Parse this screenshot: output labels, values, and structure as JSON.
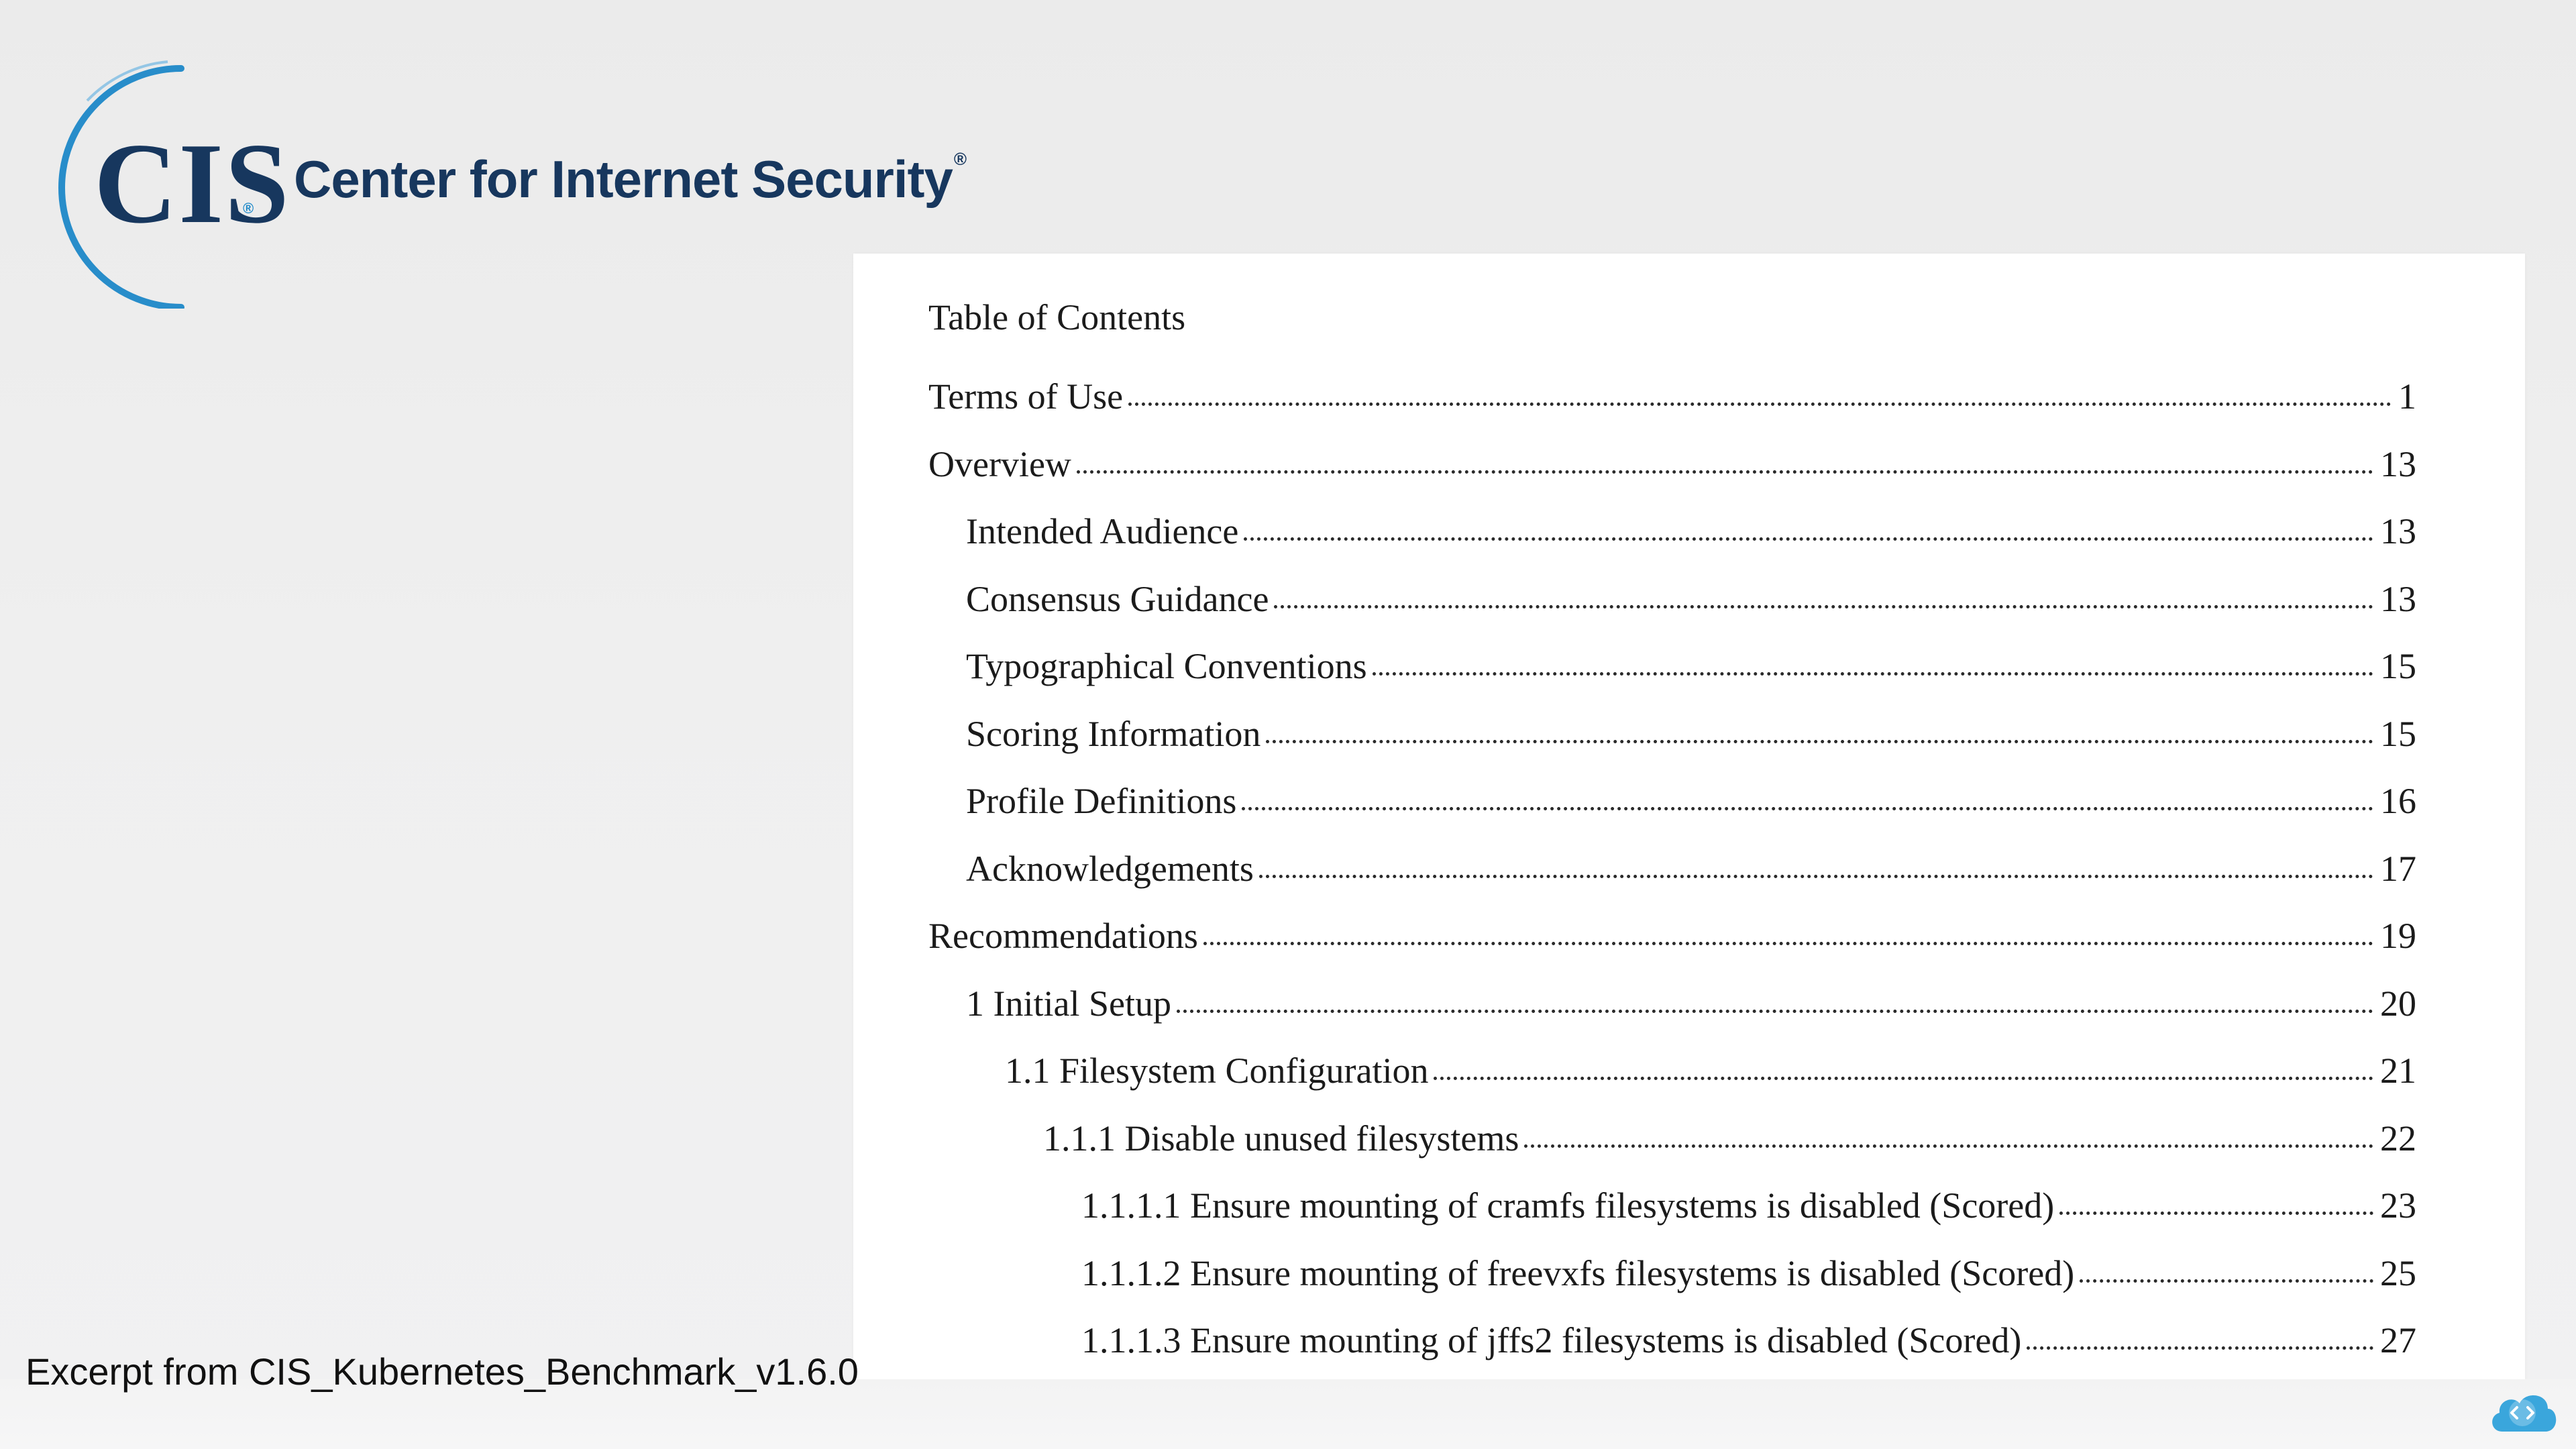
{
  "logo": {
    "mark": "CIS",
    "registered_symbol": "®",
    "name": "Center for Internet Security",
    "name_registered": "®"
  },
  "toc": {
    "title": "Table of Contents",
    "entries": [
      {
        "text": "Terms of Use",
        "page": "1",
        "level": 0
      },
      {
        "text": "Overview",
        "page": "13",
        "level": 0
      },
      {
        "text": "Intended Audience",
        "page": "13",
        "level": 1
      },
      {
        "text": "Consensus Guidance",
        "page": "13",
        "level": 1
      },
      {
        "text": "Typographical Conventions",
        "page": "15",
        "level": 1
      },
      {
        "text": "Scoring Information",
        "page": "15",
        "level": 1
      },
      {
        "text": "Profile Definitions",
        "page": "16",
        "level": 1
      },
      {
        "text": "Acknowledgements",
        "page": "17",
        "level": 1
      },
      {
        "text": "Recommendations",
        "page": "19",
        "level": 0
      },
      {
        "text": "1 Initial Setup",
        "page": "20",
        "level": 1
      },
      {
        "text": "1.1 Filesystem Configuration",
        "page": "21",
        "level": 2
      },
      {
        "text": "1.1.1 Disable unused filesystems",
        "page": "22",
        "level": 3
      },
      {
        "text": "1.1.1.1 Ensure mounting of cramfs filesystems is disabled (Scored)",
        "page": "23",
        "level": 4
      },
      {
        "text": "1.1.1.2 Ensure mounting of freevxfs filesystems is disabled (Scored)",
        "page": "25",
        "level": 4
      },
      {
        "text": "1.1.1.3 Ensure mounting of jffs2 filesystems is disabled (Scored)",
        "page": "27",
        "level": 4
      }
    ]
  },
  "caption": "Excerpt from CIS_Kubernetes_Benchmark_v1.6.0",
  "colors": {
    "brand_navy": "#17375e",
    "brand_blue": "#1e88c8",
    "badge_blue": "#3aa6dc"
  },
  "icons": {
    "corner_badge": "code-cloud-icon"
  }
}
